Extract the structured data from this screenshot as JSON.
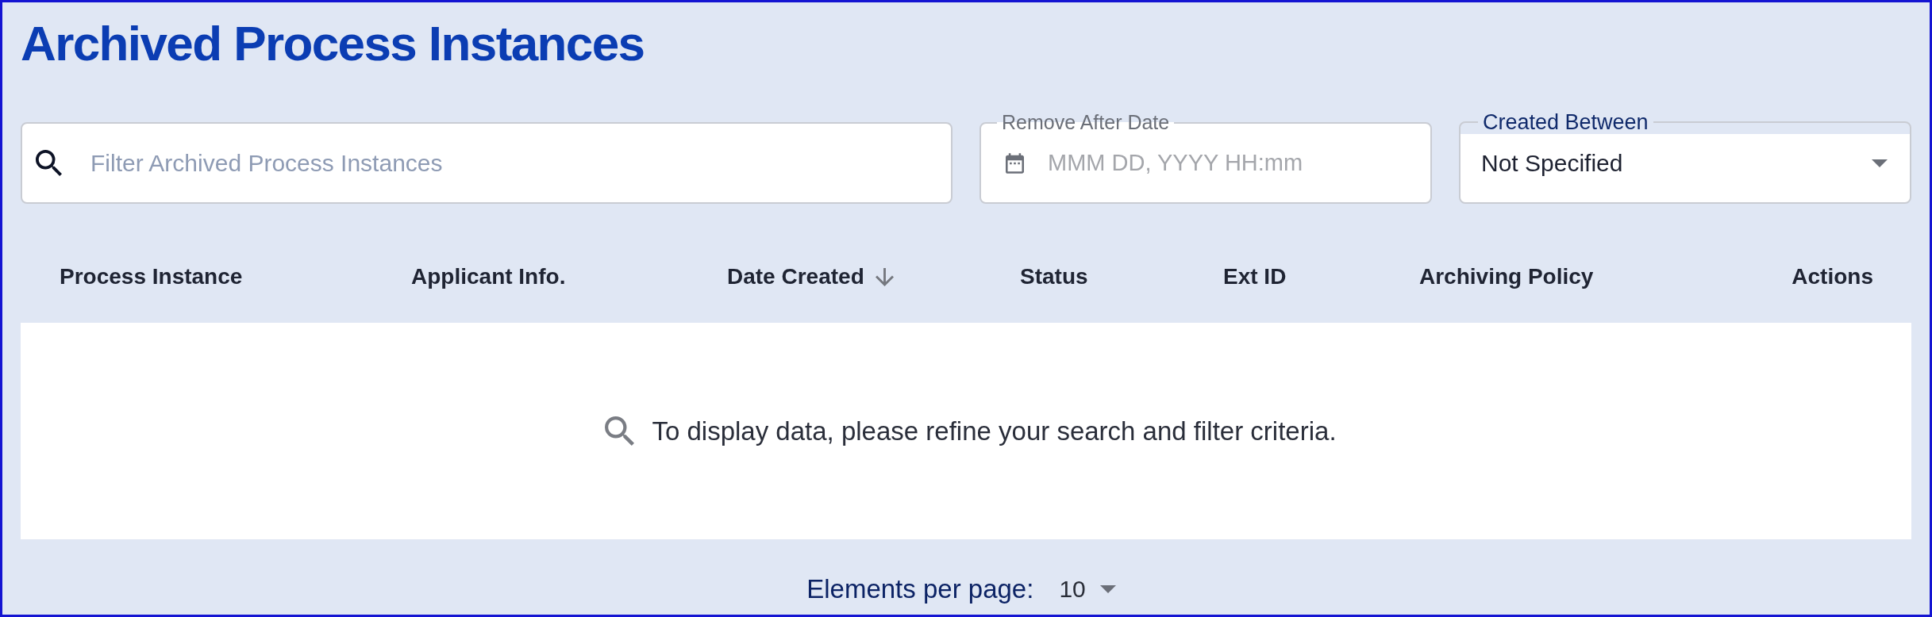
{
  "title": "Archived Process Instances",
  "filters": {
    "search": {
      "placeholder": "Filter Archived Process Instances"
    },
    "remove_after_date": {
      "label": "Remove After Date",
      "placeholder": "MMM DD, YYYY HH:mm"
    },
    "created_between": {
      "label": "Created Between",
      "value": "Not Specified"
    }
  },
  "table": {
    "columns": [
      {
        "label": "Process Instance",
        "sorted": false
      },
      {
        "label": "Applicant Info.",
        "sorted": false
      },
      {
        "label": "Date Created",
        "sorted": true
      },
      {
        "label": "Status",
        "sorted": false
      },
      {
        "label": "Ext ID",
        "sorted": false
      },
      {
        "label": "Archiving Policy",
        "sorted": false
      },
      {
        "label": "Actions",
        "sorted": false
      }
    ],
    "empty_message": "To display data, please refine your search and filter criteria."
  },
  "pagination": {
    "label": "Elements per page:",
    "value": "10"
  }
}
